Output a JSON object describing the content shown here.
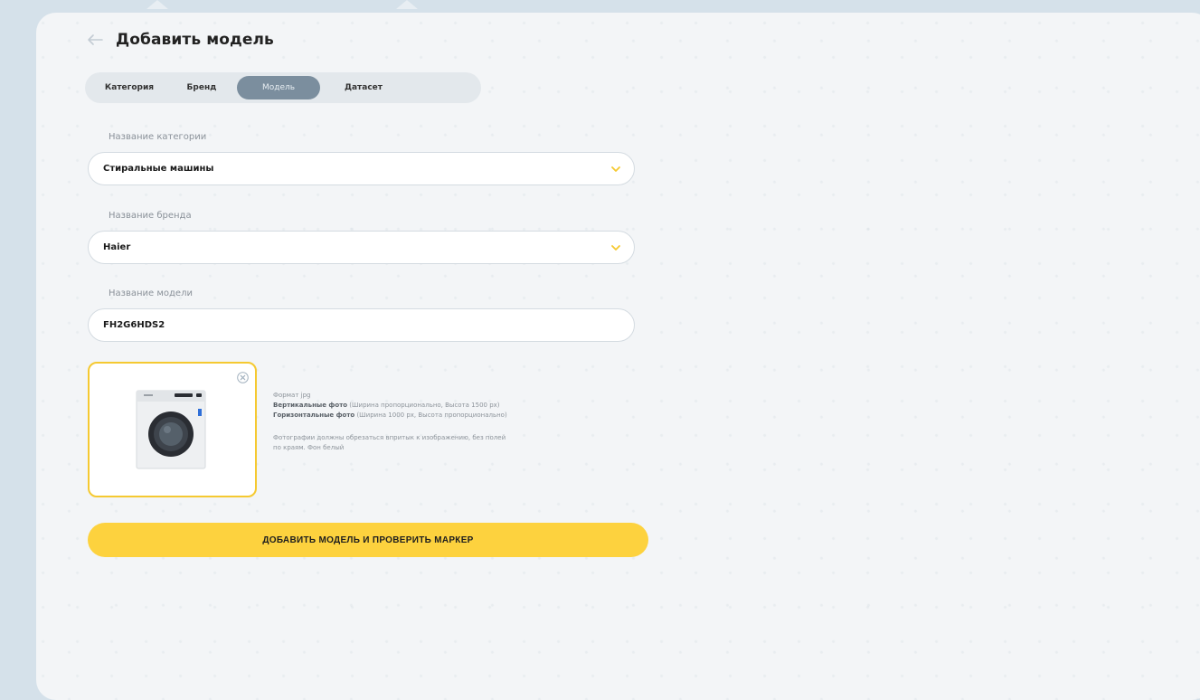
{
  "header": {
    "title": "Добавить модель"
  },
  "tabs": [
    {
      "label": "Категория",
      "active": false
    },
    {
      "label": "Бренд",
      "active": false
    },
    {
      "label": "Модель",
      "active": true
    },
    {
      "label": "Датасет",
      "active": false
    }
  ],
  "form": {
    "category": {
      "label": "Название категории",
      "value": "Стиральные машины",
      "icon": "chevron-down-icon"
    },
    "brand": {
      "label": "Название бренда",
      "value": "Haier",
      "icon": "chevron-down-icon"
    },
    "model": {
      "label": "Название модели",
      "value": "FH2G6HDS2"
    }
  },
  "upload": {
    "close_icon": "close-icon",
    "image": "washing-machine-photo",
    "format_line": "Формат jpg",
    "vertical_title": "Вертикальные фото",
    "vertical_text": "(Ширина пропорционально, Высота 1500 px)",
    "horizontal_title": "Горизонтальные фото",
    "horizontal_text": "(Ширина 1000 px, Высота пропорционально)",
    "note_line1": "Фотографии должны обрезаться впритык к изображению, без полей",
    "note_line2": "по краям. Фон белый"
  },
  "submit": {
    "label": "ДОБАВИТЬ МОДЕЛЬ И ПРОВЕРИТЬ МАРКЕР"
  },
  "colors": {
    "background": "#d5e1ea",
    "panel": "#f3f5f7",
    "accent": "#fdd23e",
    "upload_border": "#f5c931",
    "active_tab": "#7b8e9e",
    "chevron": "#f5c931"
  }
}
